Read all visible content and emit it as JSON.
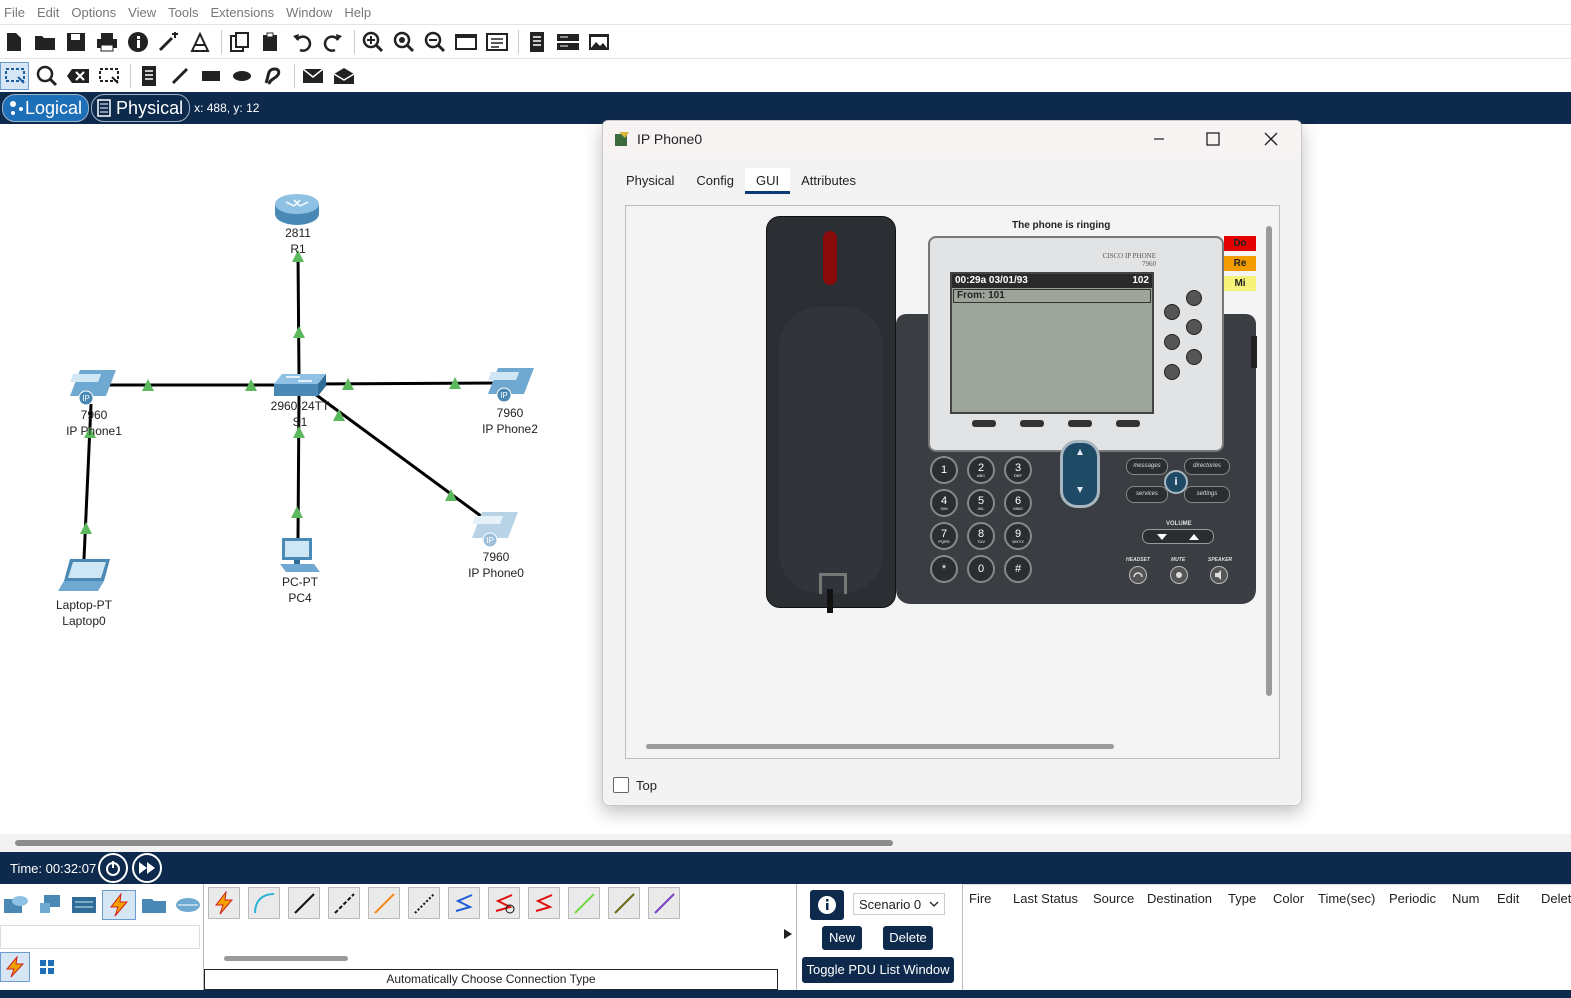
{
  "menu": [
    "File",
    "Edit",
    "Options",
    "View",
    "Tools",
    "Extensions",
    "Window",
    "Help"
  ],
  "toolbar1_icons": [
    "new-icon",
    "open-icon",
    "save-icon",
    "print-icon",
    "info-icon",
    "wizard-icon",
    "network-info-icon",
    "copy-icon",
    "paste-icon",
    "undo-icon",
    "redo-icon",
    "zoom-in-icon",
    "zoom-reset-icon",
    "zoom-out-icon",
    "drawing-palette-icon",
    "custom-device-icon",
    "pdu-list-icon",
    "cluster-icon",
    "screenshot-icon"
  ],
  "toolbar2_icons": [
    "select-icon",
    "inspect-icon",
    "delete-icon",
    "resize-icon",
    "note-icon",
    "line-draw-icon",
    "rectangle-icon",
    "ellipse-icon",
    "freeform-icon",
    "simple-pdu-icon",
    "complex-pdu-icon"
  ],
  "mode": {
    "logical": "Logical",
    "physical": "Physical",
    "coords": "x: 488, y: 12"
  },
  "devices": {
    "router": {
      "model": "2811",
      "name": "R1"
    },
    "switch": {
      "model": "2960-24TT",
      "name": "S1"
    },
    "phone1": {
      "model": "7960",
      "name": "IP Phone1"
    },
    "phone2": {
      "model": "7960",
      "name": "IP Phone2"
    },
    "phone0": {
      "model": "7960",
      "name": "IP Phone0"
    },
    "pc": {
      "model": "PC-PT",
      "name": "PC4"
    },
    "laptop": {
      "model": "Laptop-PT",
      "name": "Laptop0"
    },
    "ip_badge": "IP"
  },
  "window": {
    "title": "IP Phone0",
    "tabs": [
      "Physical",
      "Config",
      "GUI",
      "Attributes"
    ],
    "active_tab": "GUI",
    "top_checkbox": "Top"
  },
  "phone_gui": {
    "status": "The phone is ringing",
    "brand": "CISCO IP PHONE",
    "brand_model": "7960",
    "screen_time": "00:29a 03/01/93",
    "screen_ext": "102",
    "screen_from": "From: 101",
    "side_buttons": [
      "Do",
      "Re",
      "Mi"
    ],
    "keypad": [
      {
        "n": "1",
        "s": ""
      },
      {
        "n": "2",
        "s": "ABC"
      },
      {
        "n": "3",
        "s": "DEF"
      },
      {
        "n": "4",
        "s": "GHI"
      },
      {
        "n": "5",
        "s": "JKL"
      },
      {
        "n": "6",
        "s": "MNO"
      },
      {
        "n": "7",
        "s": "PQRS"
      },
      {
        "n": "8",
        "s": "TUV"
      },
      {
        "n": "9",
        "s": "WXYZ"
      },
      {
        "n": "*",
        "s": ""
      },
      {
        "n": "0",
        "s": ""
      },
      {
        "n": "#",
        "s": ""
      }
    ],
    "func_buttons": [
      "messages",
      "directories",
      "services",
      "settings"
    ],
    "info_button": "i",
    "volume_label": "VOLUME",
    "headset_label": "HEADSET",
    "mute_label": "MUTE",
    "speaker_label": "SPEAKER"
  },
  "timebar": {
    "time": "Time: 00:32:07"
  },
  "connections": {
    "label": "Automatically Choose Connection Type"
  },
  "scenario": {
    "selected": "Scenario 0",
    "new": "New",
    "delete": "Delete",
    "toggle": "Toggle PDU List Window"
  },
  "pdu_columns": [
    "Fire",
    "Last Status",
    "Source",
    "Destination",
    "Type",
    "Color",
    "Time(sec)",
    "Periodic",
    "Num",
    "Edit",
    "Delete"
  ],
  "colors": {
    "navy": "#0d2a4c",
    "link": "#000000",
    "link_up": "#5cb85c"
  }
}
